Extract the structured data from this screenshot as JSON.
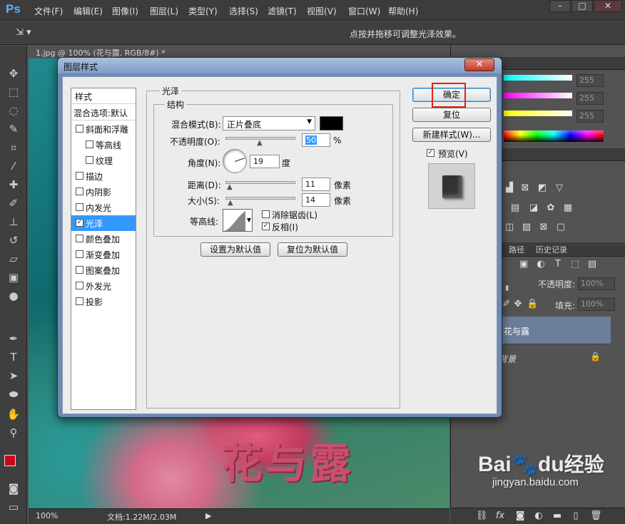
{
  "app": {
    "logo": "Ps",
    "menu": [
      "文件(F)",
      "编辑(E)",
      "图像(I)",
      "图层(L)",
      "类型(Y)",
      "选择(S)",
      "滤镜(T)",
      "视图(V)",
      "窗口(W)",
      "帮助(H)"
    ],
    "options_hint": "点按并拖移可调整光泽效果。",
    "doc_tab": "1.jpg @ 100% (花与露, RGB/8#) *"
  },
  "canvas": {
    "text": "花与露"
  },
  "status": {
    "zoom": "100%",
    "doc": "文档:1.22M/2.03M"
  },
  "color_panel": {
    "values": [
      "255",
      "255",
      "255"
    ]
  },
  "layers_panel": {
    "tabs": [
      "路径",
      "历史记录"
    ],
    "opacity_label": "不透明度:",
    "opacity_value": "100%",
    "fill_label": "填充:",
    "fill_value": "100%",
    "layers": [
      {
        "name": "花与露"
      },
      {
        "name": "背景"
      }
    ]
  },
  "dialog": {
    "title": "图层样式",
    "styles_header": "样式",
    "blending_options": "混合选项:默认",
    "styles": [
      {
        "label": "斜面和浮雕",
        "checked": false,
        "indent": false
      },
      {
        "label": "等高线",
        "checked": false,
        "indent": true
      },
      {
        "label": "纹理",
        "checked": false,
        "indent": true
      },
      {
        "label": "描边",
        "checked": false,
        "indent": false
      },
      {
        "label": "内阴影",
        "checked": false,
        "indent": false
      },
      {
        "label": "内发光",
        "checked": false,
        "indent": false
      },
      {
        "label": "光泽",
        "checked": true,
        "indent": false,
        "selected": true
      },
      {
        "label": "颜色叠加",
        "checked": false,
        "indent": false
      },
      {
        "label": "渐变叠加",
        "checked": false,
        "indent": false
      },
      {
        "label": "图案叠加",
        "checked": false,
        "indent": false
      },
      {
        "label": "外发光",
        "checked": false,
        "indent": false
      },
      {
        "label": "投影",
        "checked": false,
        "indent": false
      }
    ],
    "section_title": "光泽",
    "structure_title": "结构",
    "blend_mode_label": "混合模式(B):",
    "blend_mode_value": "正片叠底",
    "blend_color": "#000000",
    "opacity_label": "不透明度(O):",
    "opacity_value": "50",
    "opacity_unit": "%",
    "angle_label": "角度(N):",
    "angle_value": "19",
    "angle_unit": "度",
    "distance_label": "距离(D):",
    "distance_value": "11",
    "distance_unit": "像素",
    "size_label": "大小(S):",
    "size_value": "14",
    "size_unit": "像素",
    "contour_label": "等高线:",
    "antialias_label": "消除锯齿(L)",
    "antialias_checked": false,
    "invert_label": "反相(I)",
    "invert_checked": true,
    "set_default": "设置为默认值",
    "reset_default": "复位为默认值",
    "ok": "确定",
    "reset": "复位",
    "new_style": "新建样式(W)...",
    "preview_label": "预览(V)",
    "preview_checked": true
  },
  "watermark": {
    "brand": "Bai",
    "brand2": "du",
    "suffix": "经验",
    "url": "jingyan.baidu.com"
  }
}
